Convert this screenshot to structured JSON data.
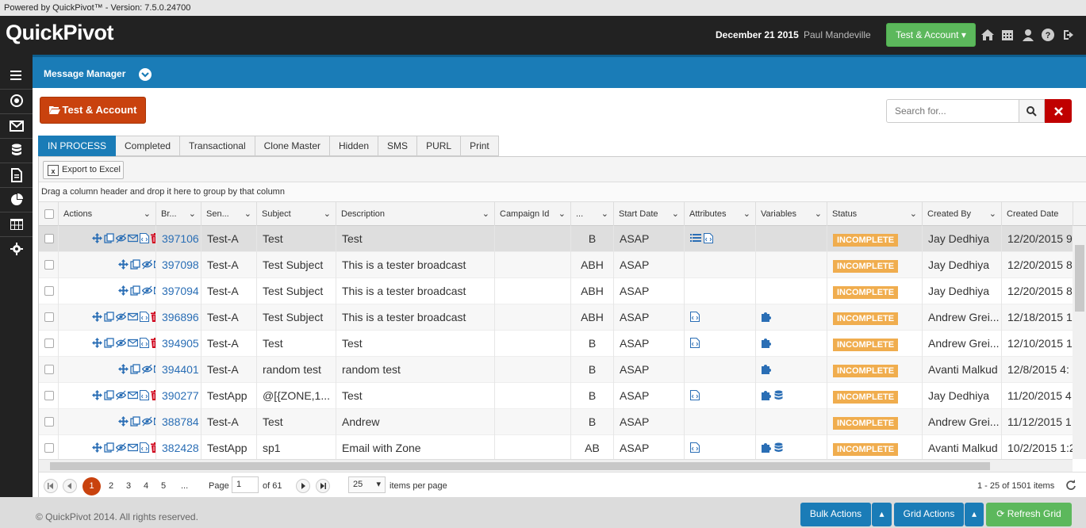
{
  "powered_by": "Powered by QuickPivot™ - Version: 7.5.0.24700",
  "app": {
    "logo_a": "Quick",
    "logo_b": "Pivot",
    "date": "December 21 2015",
    "user": "Paul Mandeville",
    "account_button": "Test & Account"
  },
  "header_icons": [
    "home-icon",
    "calendar-icon",
    "user-icon",
    "help-icon",
    "logout-icon"
  ],
  "sidebar": [
    "menu-icon",
    "target-icon",
    "envelope-icon",
    "database-icon",
    "document-icon",
    "pie-chart-icon",
    "table-icon",
    "gear-icon"
  ],
  "message_manager": {
    "title": "Message Manager"
  },
  "project_button": "Test & Account",
  "search": {
    "placeholder": "Search for..."
  },
  "tabs": [
    "IN PROCESS",
    "Completed",
    "Transactional",
    "Clone Master",
    "Hidden",
    "SMS",
    "PURL",
    "Print"
  ],
  "toolbar": {
    "export": "Export to Excel"
  },
  "group_hint": "Drag a column header and drop it here to group by that column",
  "columns": [
    "",
    "Actions",
    "Br...",
    "Sen...",
    "Subject",
    "Description",
    "Campaign Id",
    "...",
    "Start Date",
    "Attributes",
    "Variables",
    "Status",
    "Created By",
    "Created Date"
  ],
  "rows": [
    {
      "id": "397106",
      "sender": "Test-A",
      "subject": "Test",
      "description": "Test",
      "campaign": "",
      "seg": "B",
      "start": "ASAP",
      "attrs": [
        "list",
        "html"
      ],
      "vars": [],
      "status": "INCOMPLETE",
      "created_by": "Jay Dedhiya",
      "created_date": "12/20/2015 9:",
      "actions": 6
    },
    {
      "id": "397098",
      "sender": "Test-A",
      "subject": "Test Subject",
      "description": "This is a tester broadcast",
      "campaign": "",
      "seg": "ABH",
      "start": "ASAP",
      "attrs": [],
      "vars": [],
      "status": "INCOMPLETE",
      "created_by": "Jay Dedhiya",
      "created_date": "12/20/2015 8:",
      "actions": 4
    },
    {
      "id": "397094",
      "sender": "Test-A",
      "subject": "Test Subject",
      "description": "This is a tester broadcast",
      "campaign": "",
      "seg": "ABH",
      "start": "ASAP",
      "attrs": [],
      "vars": [],
      "status": "INCOMPLETE",
      "created_by": "Jay Dedhiya",
      "created_date": "12/20/2015 8:",
      "actions": 4
    },
    {
      "id": "396896",
      "sender": "Test-A",
      "subject": "Test Subject",
      "description": "This is a tester broadcast",
      "campaign": "",
      "seg": "ABH",
      "start": "ASAP",
      "attrs": [
        "html"
      ],
      "vars": [
        "puzzle"
      ],
      "status": "INCOMPLETE",
      "created_by": "Andrew Grei...",
      "created_date": "12/18/2015 1:",
      "actions": 6
    },
    {
      "id": "394905",
      "sender": "Test-A",
      "subject": "Test",
      "description": "Test",
      "campaign": "",
      "seg": "B",
      "start": "ASAP",
      "attrs": [
        "html"
      ],
      "vars": [
        "puzzle"
      ],
      "status": "INCOMPLETE",
      "created_by": "Andrew Grei...",
      "created_date": "12/10/2015 1:",
      "actions": 6
    },
    {
      "id": "394401",
      "sender": "Test-A",
      "subject": "random test",
      "description": "random test",
      "campaign": "",
      "seg": "B",
      "start": "ASAP",
      "attrs": [],
      "vars": [
        "puzzle"
      ],
      "status": "INCOMPLETE",
      "created_by": "Avanti Malkud",
      "created_date": "12/8/2015 4:",
      "actions": 4
    },
    {
      "id": "390277",
      "sender": "TestApp",
      "subject": "@[{ZONE,1...",
      "description": "Test",
      "campaign": "",
      "seg": "B",
      "start": "ASAP",
      "attrs": [
        "html"
      ],
      "vars": [
        "puzzle",
        "database"
      ],
      "status": "INCOMPLETE",
      "created_by": "Jay Dedhiya",
      "created_date": "11/20/2015 4:",
      "actions": 6
    },
    {
      "id": "388784",
      "sender": "Test-A",
      "subject": "Test",
      "description": "Andrew",
      "campaign": "",
      "seg": "B",
      "start": "ASAP",
      "attrs": [],
      "vars": [],
      "status": "INCOMPLETE",
      "created_by": "Andrew Grei...",
      "created_date": "11/12/2015 1:",
      "actions": 4
    },
    {
      "id": "382428",
      "sender": "TestApp",
      "subject": "sp1",
      "description": "Email with Zone",
      "campaign": "",
      "seg": "AB",
      "start": "ASAP",
      "attrs": [
        "html"
      ],
      "vars": [
        "puzzle",
        "database"
      ],
      "status": "INCOMPLETE",
      "created_by": "Avanti Malkud",
      "created_date": "10/2/2015 1:2",
      "actions": 6
    }
  ],
  "pager": {
    "pages": [
      "1",
      "2",
      "3",
      "4",
      "5",
      "..."
    ],
    "page_label": "Page",
    "page_value": "1",
    "of_label": "of 61",
    "per_page": "25",
    "per_page_label": "items per page",
    "summary": "1 - 25 of 1501 items"
  },
  "footer": {
    "copyright": "© QuickPivot 2014. All rights reserved.",
    "bulk": "Bulk Actions",
    "grid": "Grid Actions",
    "refresh": "Refresh Grid"
  },
  "colors": {
    "accent_blue": "#1a7cb7",
    "orange": "#c9420e",
    "green": "#5cb85c",
    "badge": "#f0ad4e",
    "red": "#c00000"
  }
}
